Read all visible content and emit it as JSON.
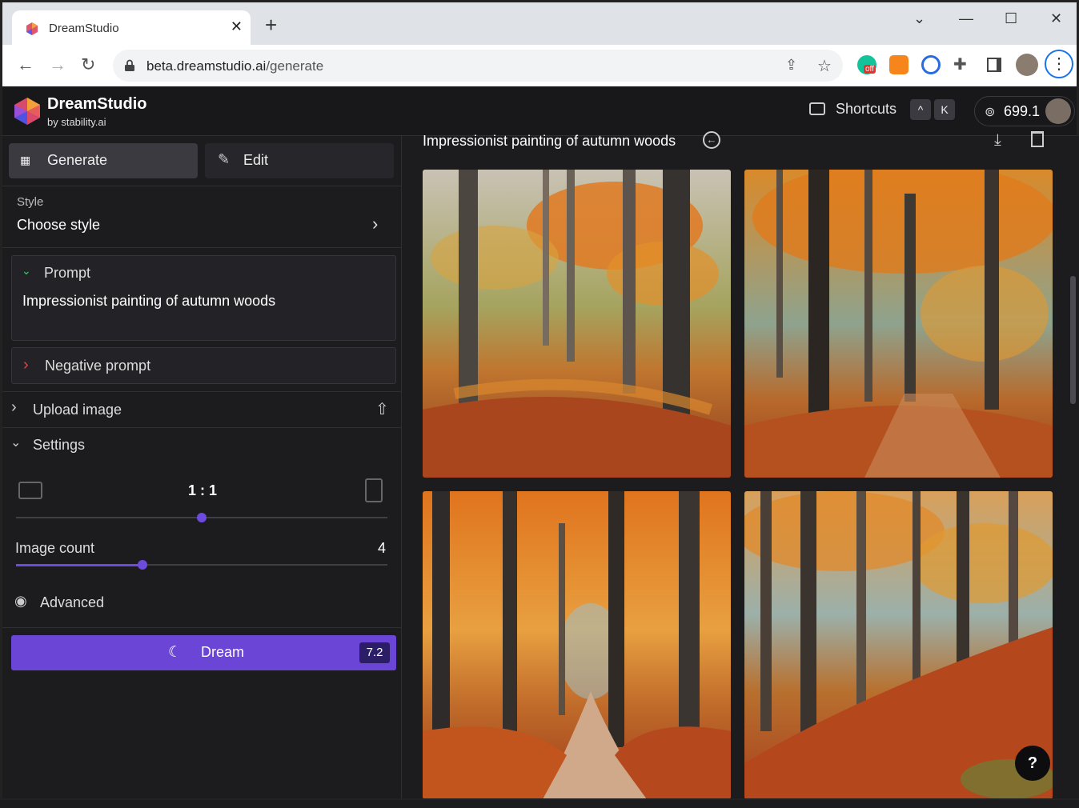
{
  "browser": {
    "tab_title": "DreamStudio",
    "url_host": "beta.dreamstudio.ai",
    "url_path": "/generate",
    "grammarly_badge": "off"
  },
  "header": {
    "brand": "DreamStudio",
    "brand_sub": "by stability.ai",
    "shortcuts_label": "Shortcuts",
    "shortcut_key1": "^",
    "shortcut_key2": "K",
    "credits": "699.1"
  },
  "sidebar": {
    "tabs": [
      {
        "label": "Generate"
      },
      {
        "label": "Edit"
      }
    ],
    "style_label": "Style",
    "style_value": "Choose style",
    "prompt_label": "Prompt",
    "prompt_text": "Impressionist painting of autumn woods",
    "negative_prompt_label": "Negative prompt",
    "upload_label": "Upload image",
    "settings_label": "Settings",
    "aspect_ratio": "1 : 1",
    "aspect_ratio_level": 0.5,
    "image_count_label": "Image count",
    "image_count": "4",
    "image_count_level": 0.34,
    "advanced_label": "Advanced",
    "dream_label": "Dream",
    "dream_cost": "7.2"
  },
  "main": {
    "generation_title": "Impressionist painting of autumn woods",
    "help_label": "?"
  },
  "colors": {
    "accent": "#6b46d6",
    "bg": "#1c1c1f",
    "panel": "#232327"
  }
}
